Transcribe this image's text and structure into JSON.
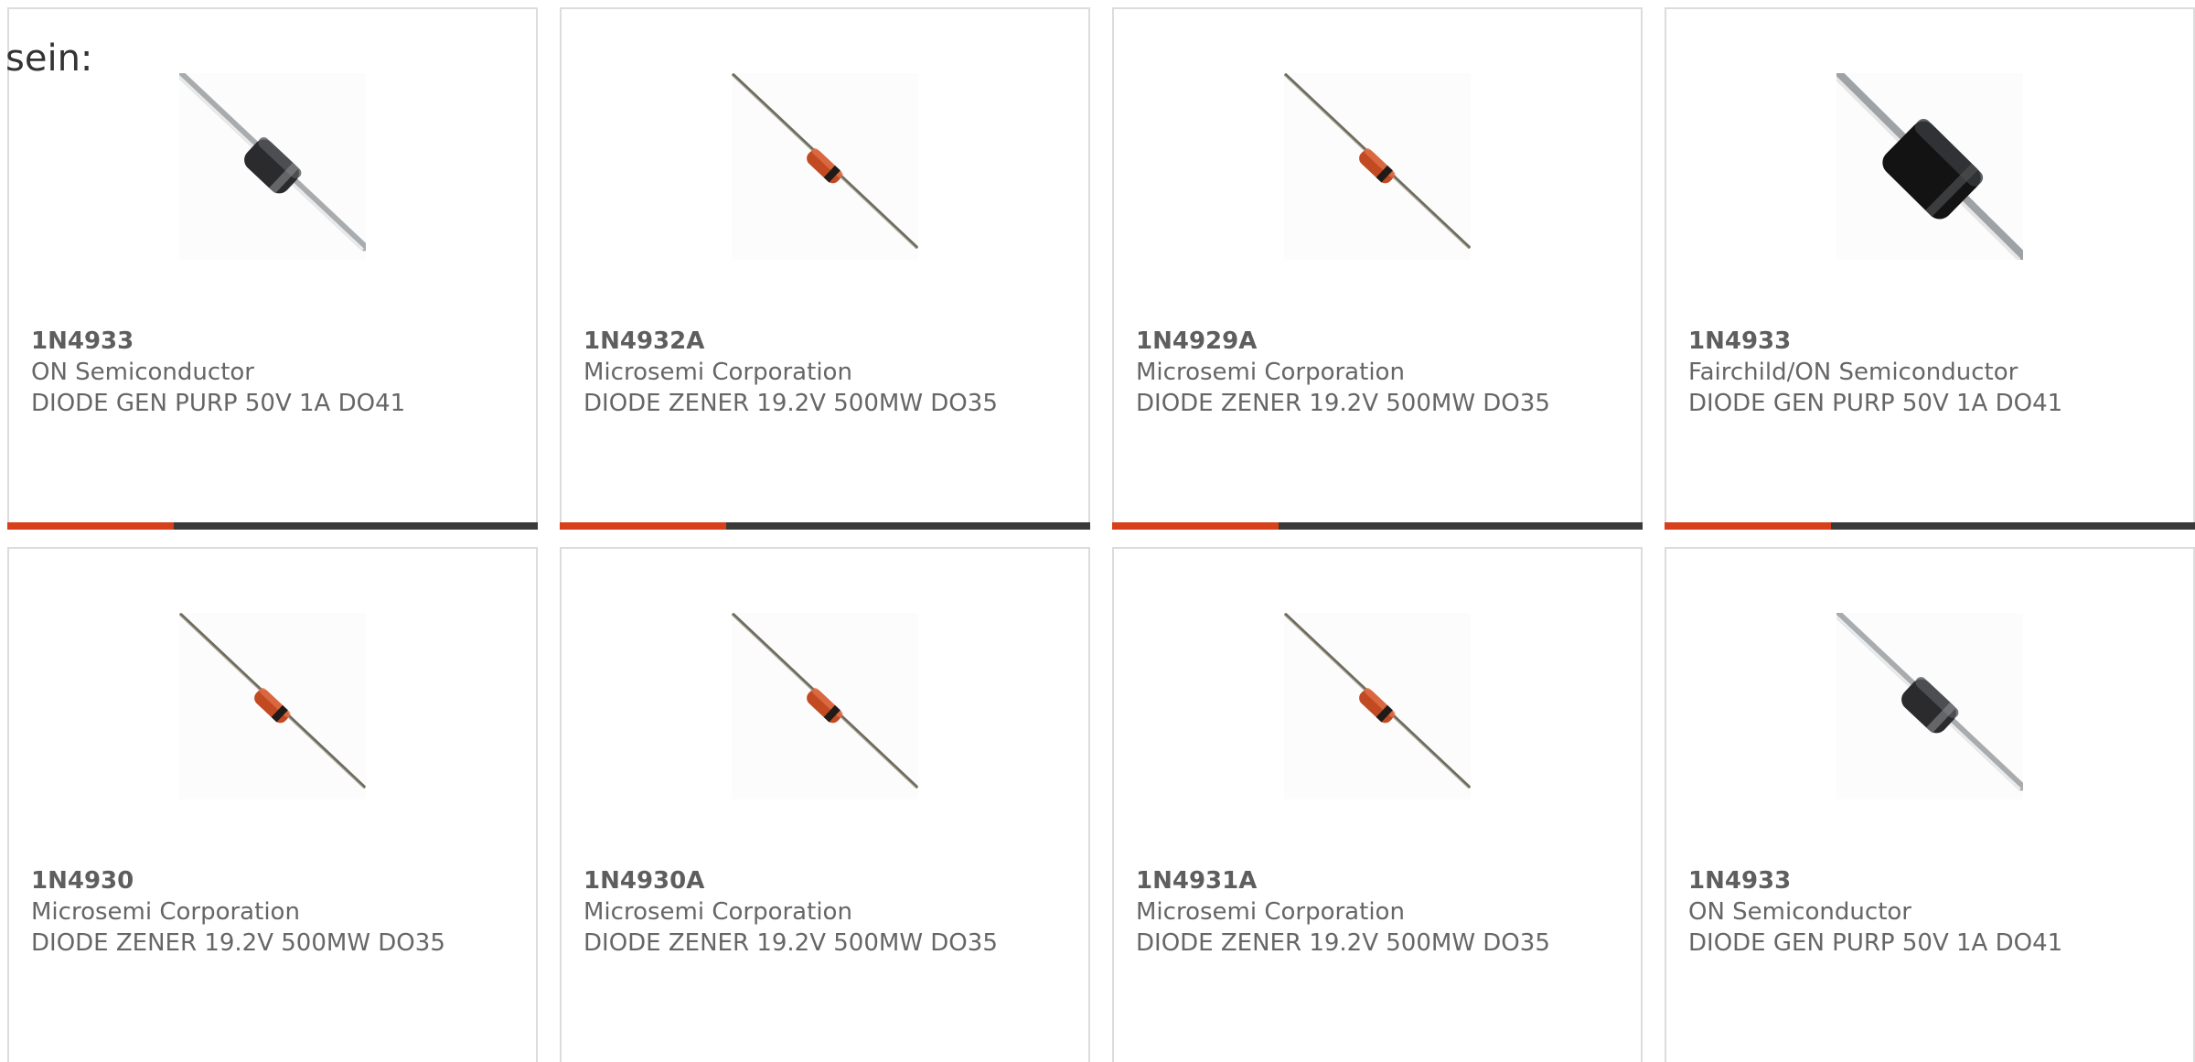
{
  "lead_text": "sein:",
  "colors": {
    "accent": "#d6401a",
    "bar": "#3a3a3a",
    "border": "#dcdcdc",
    "text": "#666666"
  },
  "cards": [
    {
      "part": "1N4933",
      "manufacturer": "ON Semiconductor",
      "description": "DIODE GEN PURP 50V 1A DO41",
      "image": "diode-do41-grey-icon"
    },
    {
      "part": "1N4932A",
      "manufacturer": "Microsemi Corporation",
      "description": "DIODE ZENER 19.2V 500MW DO35",
      "image": "diode-do35-orange-icon"
    },
    {
      "part": "1N4929A",
      "manufacturer": "Microsemi Corporation",
      "description": "DIODE ZENER 19.2V 500MW DO35",
      "image": "diode-do35-orange-icon"
    },
    {
      "part": "1N4933",
      "manufacturer": "Fairchild/ON Semiconductor",
      "description": "DIODE GEN PURP 50V 1A DO41",
      "image": "diode-do41-black-icon"
    },
    {
      "part": "1N4930",
      "manufacturer": "Microsemi Corporation",
      "description": "DIODE ZENER 19.2V 500MW DO35",
      "image": "diode-do35-orange-icon"
    },
    {
      "part": "1N4930A",
      "manufacturer": "Microsemi Corporation",
      "description": "DIODE ZENER 19.2V 500MW DO35",
      "image": "diode-do35-orange-icon"
    },
    {
      "part": "1N4931A",
      "manufacturer": "Microsemi Corporation",
      "description": "DIODE ZENER 19.2V 500MW DO35",
      "image": "diode-do35-orange-icon"
    },
    {
      "part": "1N4933",
      "manufacturer": "ON Semiconductor",
      "description": "DIODE GEN PURP 50V 1A DO41",
      "image": "diode-do41-grey-icon"
    }
  ]
}
